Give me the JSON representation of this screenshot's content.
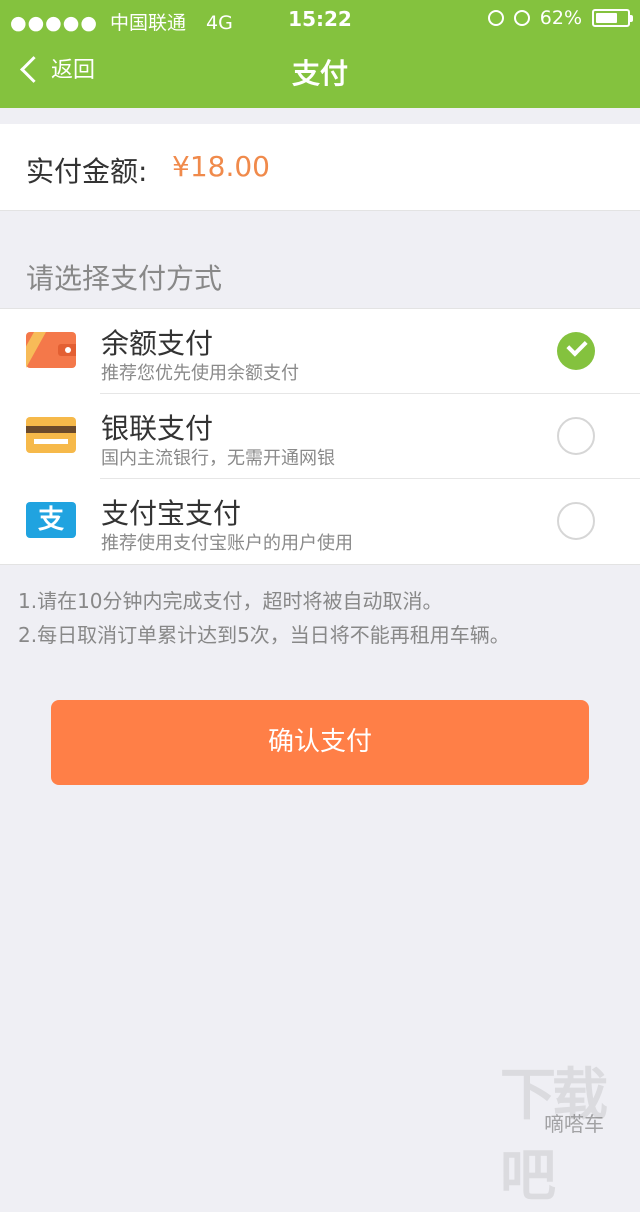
{
  "status_bar": {
    "signal_dots": "●●●●●",
    "carrier": "中国联通",
    "network": "4G",
    "time": "15:22",
    "battery": "62%"
  },
  "nav": {
    "back_label": "返回",
    "title": "支付"
  },
  "amount": {
    "label": "实付金额:",
    "value": "¥18.00"
  },
  "payment_section_title": "请选择支付方式",
  "payment_methods": [
    {
      "title": "余额支付",
      "desc": "推荐您优先使用余额支付",
      "icon": "wallet-icon",
      "selected": true
    },
    {
      "title": "银联支付",
      "desc": "国内主流银行，无需开通网银",
      "icon": "bank-card-icon",
      "selected": false
    },
    {
      "title": "支付宝支付",
      "desc": "推荐使用支付宝账户的用户使用",
      "icon": "alipay-icon",
      "alipay_glyph": "支",
      "selected": false
    }
  ],
  "notes": [
    "1.请在10分钟内完成支付，超时将被自动取消。",
    "2.每日取消订单累计达到5次，当日将不能再租用车辆。"
  ],
  "confirm_label": "确认支付",
  "watermark": {
    "logo": "下载吧",
    "text": "嘀嗒车",
    "url": "www.xiazaiba.com"
  },
  "colors": {
    "header_green": "#84c23e",
    "amount_orange": "#f08a4b",
    "button_orange": "#ff7f47",
    "background": "#efeff4"
  }
}
